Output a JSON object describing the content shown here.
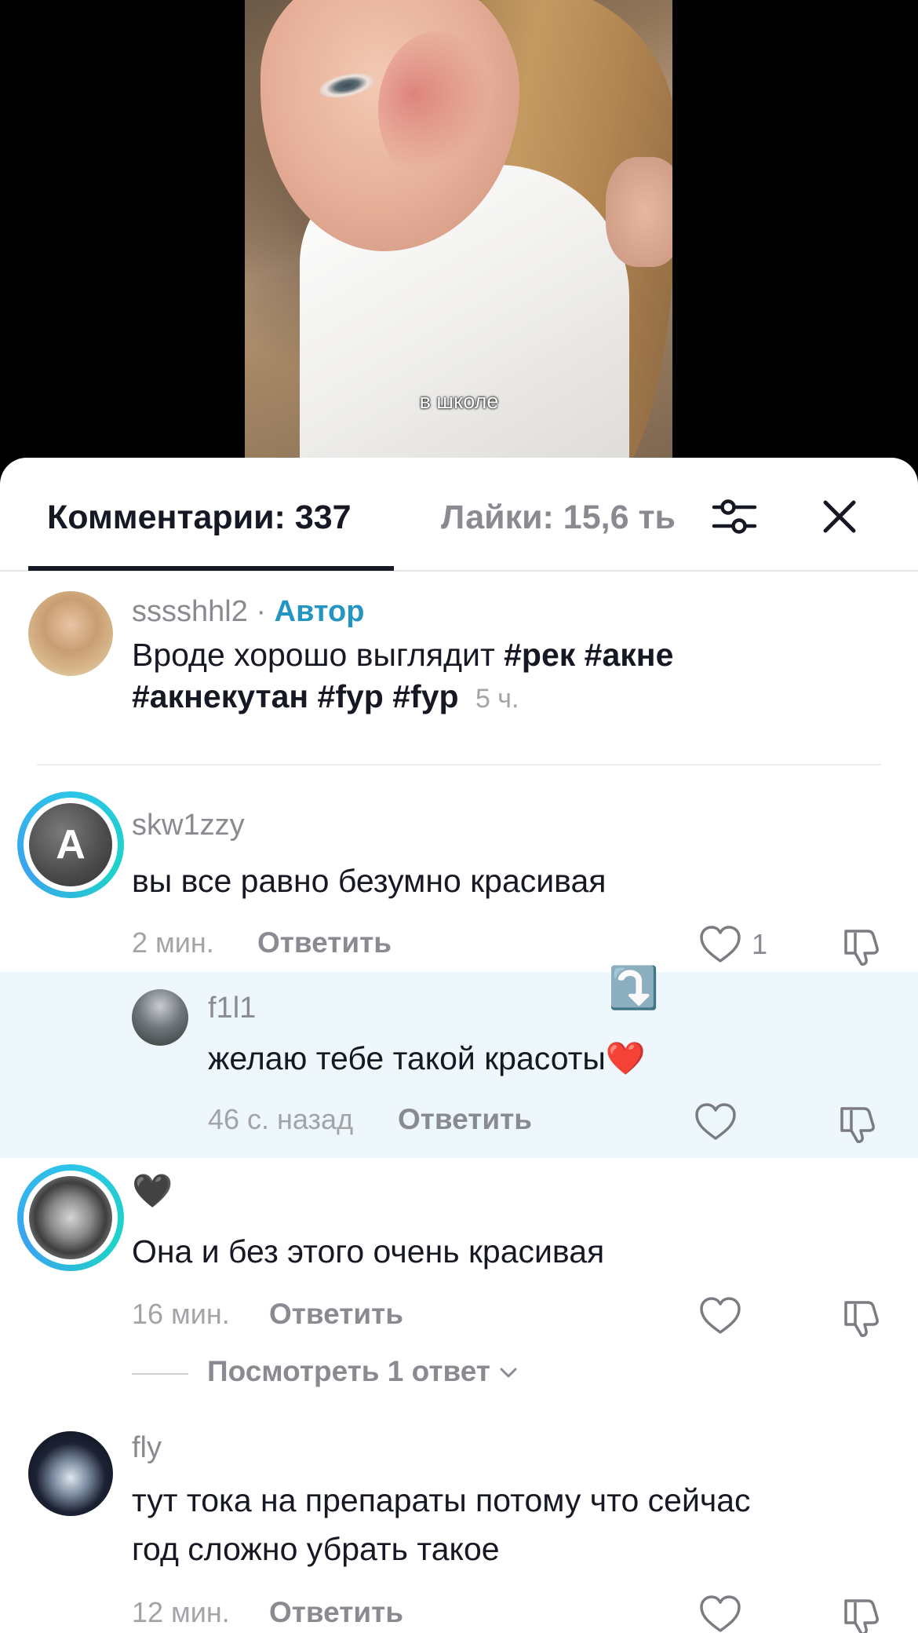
{
  "video": {
    "caption": "в школе"
  },
  "sheet": {
    "tab_comments": "Комментарии: 337",
    "tab_likes": "Лайки: 15,6 ть",
    "filter_icon": "sliders-icon",
    "close_icon": "close-icon"
  },
  "author_post": {
    "username": "sssshhl2",
    "separator": "·",
    "badge": "Автор",
    "text_plain": "Вроде хорошо выглядит ",
    "tags_line1": "#рек #акне",
    "tags_line2": "#акнекутан #fyp #fyp",
    "time": "5 ч."
  },
  "comments": [
    {
      "username": "skw1zzy",
      "avatar_letter": "A",
      "text": "вы все равно безумно красивая",
      "time": "2 мин.",
      "reply_label": "Ответить",
      "likes": "1"
    },
    {
      "username": "f1l1",
      "text": "желаю тебе такой красоты",
      "emoji": "❤️",
      "marker_emoji": "⤵️",
      "time": "46 с. назад",
      "reply_label": "Ответить"
    },
    {
      "username": "🖤",
      "text": "Она и без этого очень красивая",
      "time": "16 мин.",
      "reply_label": "Ответить",
      "view_replies": "Посмотреть 1 ответ"
    },
    {
      "username": "fly",
      "text_line1": "тут тока на препараты потому что сейчас",
      "text_line2": "год сложно убрать такое",
      "time": "12 мин.",
      "reply_label": "Ответить"
    }
  ]
}
